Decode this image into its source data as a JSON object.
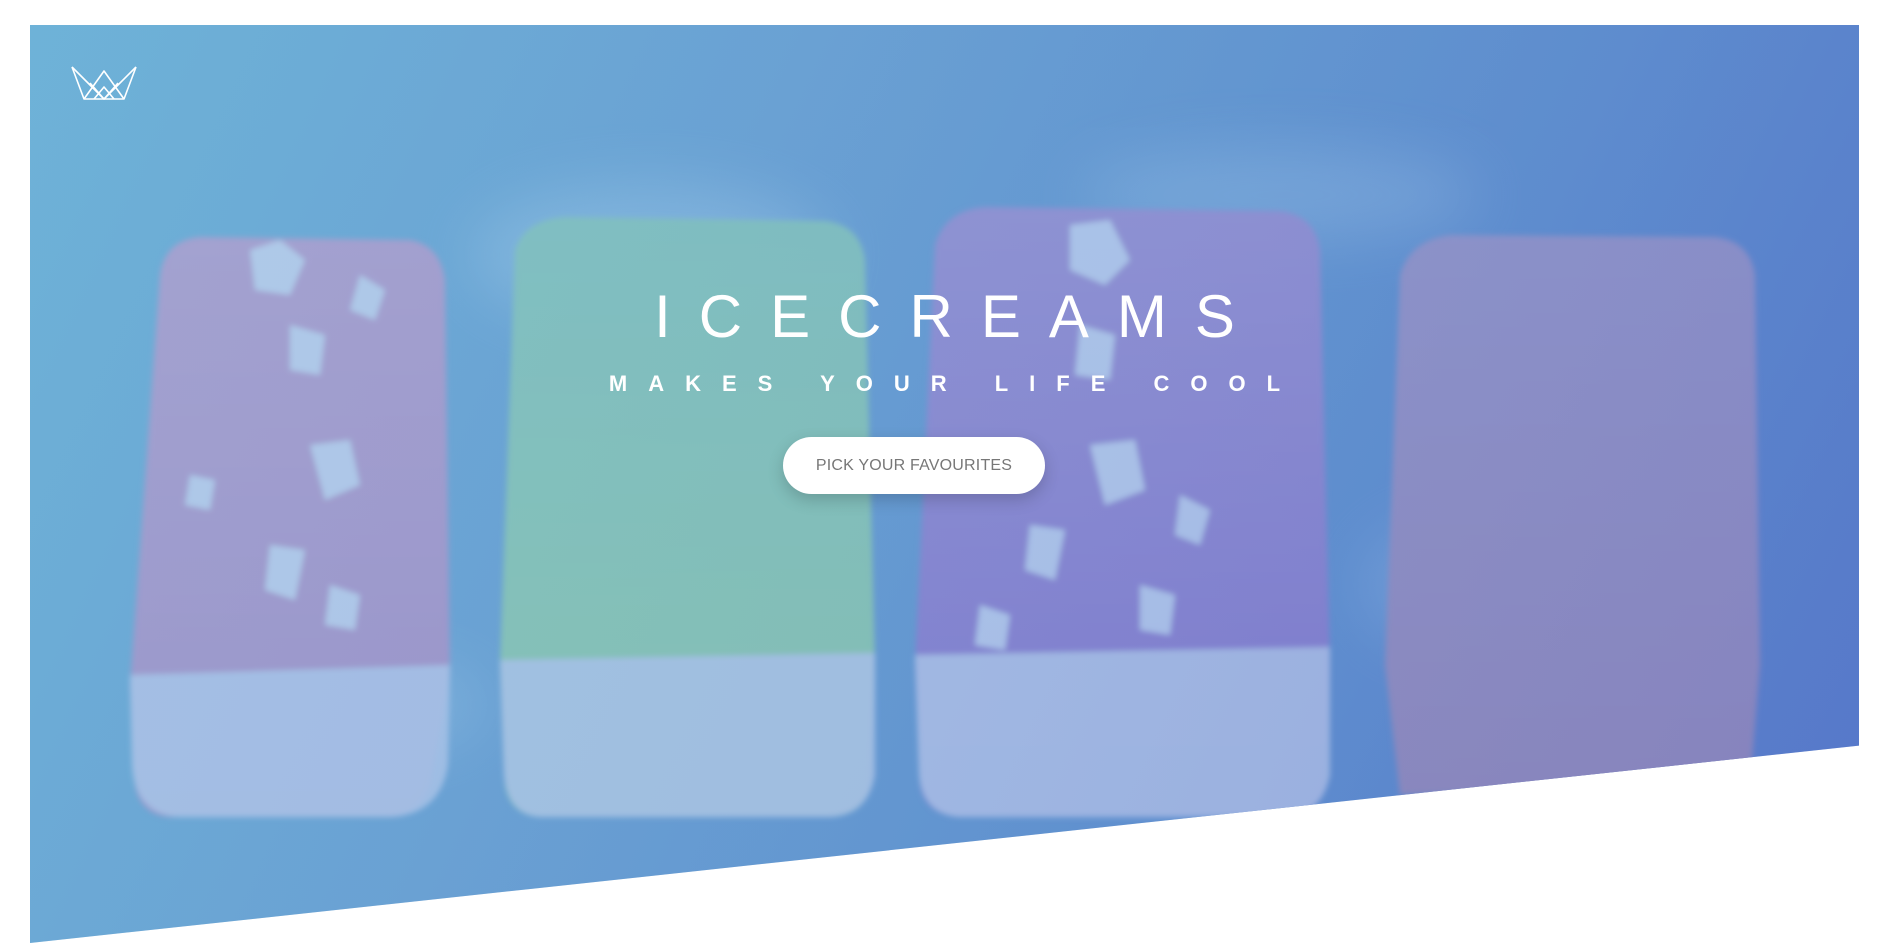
{
  "hero": {
    "title": "ICECREAMS",
    "subtitle": "MAKES YOUR LIFE COOL",
    "cta_label": "PICK YOUR FAVOURITES"
  },
  "logo": {
    "icon": "crown-icon"
  },
  "colors": {
    "hero_gradient_start": "#6aaed2",
    "hero_gradient_end": "#5679c9",
    "button_background": "#ffffff",
    "button_text": "#777777"
  }
}
